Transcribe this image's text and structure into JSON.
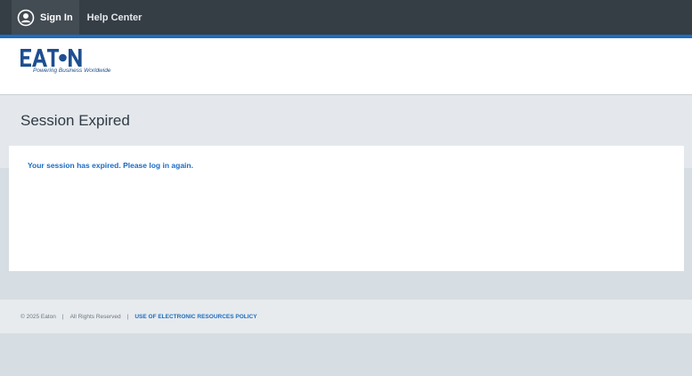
{
  "topbar": {
    "sign_in_label": "Sign In",
    "help_center_label": "Help Center",
    "sign_in_icon": "user-circle-icon"
  },
  "header": {
    "brand": "EATON",
    "tagline": "Powering Business Worldwide"
  },
  "page": {
    "title": "Session Expired",
    "message": "Your session has expired. Please log in again."
  },
  "footer": {
    "copyright": "© 2025 Eaton",
    "separator_1": "|",
    "rights": "All Rights Reserved",
    "separator_2": "|",
    "policy_link": "USE OF ELECTRONIC RESOURCES POLICY"
  },
  "colors": {
    "topbar": "#353d45",
    "accent_blue": "#1d6cc0",
    "background": "#d6dde3"
  }
}
